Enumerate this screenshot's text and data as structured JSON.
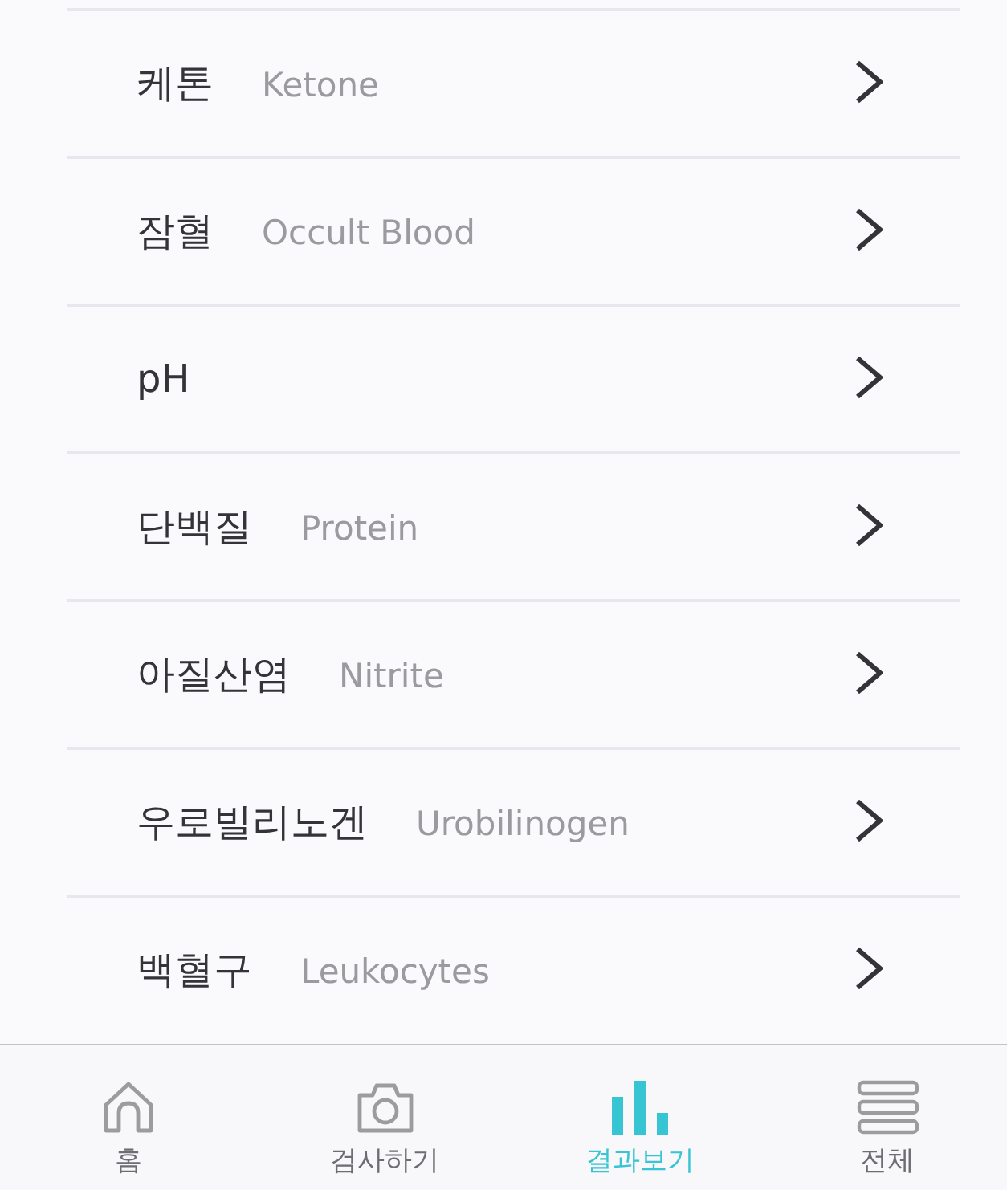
{
  "items": [
    {
      "name": "케톤",
      "english": "Ketone"
    },
    {
      "name": "잠혈",
      "english": "Occult Blood"
    },
    {
      "name": "pH"
    },
    {
      "name": "단백질",
      "english": "Protein"
    },
    {
      "name": "아질산염",
      "english": "Nitrite"
    },
    {
      "name": "우로빌리노겐",
      "english": "Urobilinogen"
    },
    {
      "name": "백혈구",
      "english": "Leukocytes"
    }
  ],
  "tab_bar": {
    "tabs": [
      {
        "label": "홈",
        "selected": false
      },
      {
        "label": "검사하기",
        "selected": false
      },
      {
        "label": "결과보기",
        "selected": true
      },
      {
        "label": "전체",
        "selected": false
      }
    ]
  }
}
